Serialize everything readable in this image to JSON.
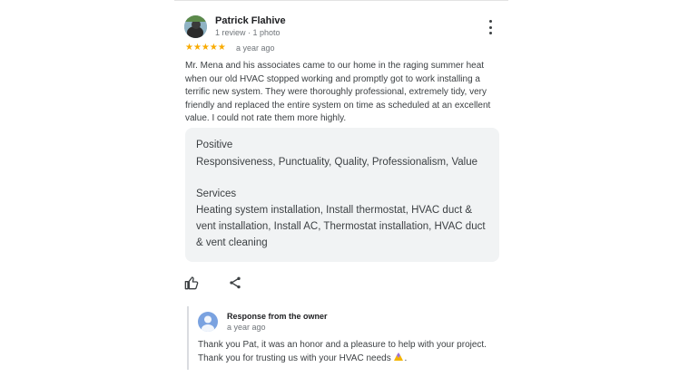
{
  "review": {
    "reviewer_name": "Patrick Flahive",
    "reviewer_meta": "1 review · 1 photo",
    "rating": 5,
    "stars": "★★★★★",
    "date": "a year ago",
    "text": "Mr. Mena and his associates came to our home in the raging summer heat when our old HVAC stopped working and promptly got to work installing a terrific new system. They were thoroughly professional, extremely tidy, very friendly and replaced the entire system on time as scheduled at an excellent value. I could not rate them more highly.",
    "attributes": {
      "positive_title": "Positive",
      "positive_value": "Responsiveness, Punctuality, Quality, Professionalism, Value",
      "services_title": "Services",
      "services_value": "Heating system installation, Install thermostat, HVAC duct & vent installation, Install AC, Thermostat installation, HVAC duct & vent cleaning"
    }
  },
  "owner_response": {
    "label": "Response from the owner",
    "date": "a year ago",
    "text": "Thank you Pat, it was an honor and a pleasure to help with your project. Thank you for trusting us with your HVAC needs",
    "emoji_icon": "hands-icon"
  },
  "icons": {
    "more": "more-vert-icon",
    "like": "thumb-up-icon",
    "share": "share-icon",
    "avatar": "reviewer-avatar",
    "owner_avatar": "owner-avatar"
  },
  "colors": {
    "stars": "#f9ab00",
    "attribute_box": "#f1f3f4",
    "owner_avatar": "#7aa2e0"
  }
}
